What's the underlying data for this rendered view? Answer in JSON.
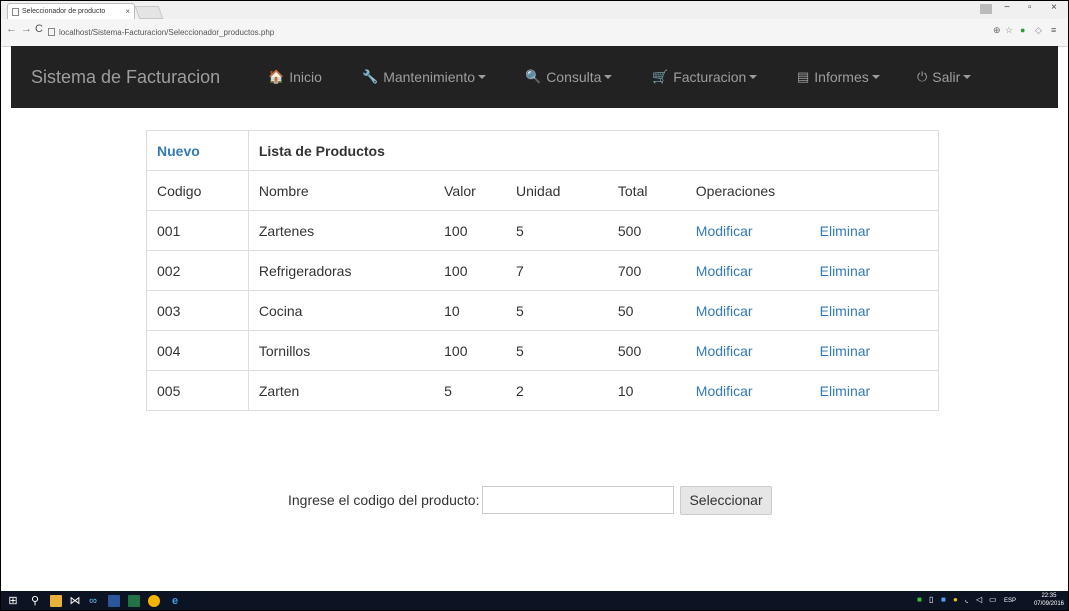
{
  "browser": {
    "tab_title": "Seleccionador de producto",
    "tab_close": "×",
    "url": "localhost/Sistema-Facturacion/Seleccionador_productos.php"
  },
  "navbar": {
    "brand": "Sistema de Facturacion",
    "items": [
      {
        "label": "Inicio",
        "icon": "home-icon",
        "glyph": "🏠"
      },
      {
        "label": "Mantenimiento",
        "icon": "wrench-icon",
        "glyph": "🔧"
      },
      {
        "label": "Consulta",
        "icon": "search-icon",
        "glyph": "🔍"
      },
      {
        "label": "Facturacion",
        "icon": "shopping-cart-icon",
        "glyph": "🛒"
      },
      {
        "label": "Informes",
        "icon": "list-alt-icon",
        "glyph": "▤"
      },
      {
        "label": "Salir",
        "icon": "power-off-icon",
        "glyph": "⏻"
      }
    ]
  },
  "table": {
    "new_label": "Nuevo",
    "title": "Lista de Productos",
    "headers": [
      "Codigo",
      "Nombre",
      "Valor",
      "Unidad",
      "Total",
      "Operaciones"
    ],
    "modify_label": "Modificar",
    "delete_label": "Eliminar",
    "rows": [
      {
        "codigo": "001",
        "nombre": "Zartenes",
        "valor": "100",
        "unidad": "5",
        "total": "500"
      },
      {
        "codigo": "002",
        "nombre": "Refrigeradoras",
        "valor": "100",
        "unidad": "7",
        "total": "700"
      },
      {
        "codigo": "003",
        "nombre": "Cocina",
        "valor": "10",
        "unidad": "5",
        "total": "50"
      },
      {
        "codigo": "004",
        "nombre": "Tornillos",
        "valor": "100",
        "unidad": "5",
        "total": "500"
      },
      {
        "codigo": "005",
        "nombre": "Zarten",
        "valor": "5",
        "unidad": "2",
        "total": "10"
      }
    ]
  },
  "form": {
    "label": "Ingrese el codigo del producto:",
    "input_value": "",
    "button": "Seleccionar"
  },
  "taskbar": {
    "lang": "ESP",
    "time": "22:35",
    "date": "07/09/2016"
  },
  "colors": {
    "navbar_bg": "#222222",
    "navbar_text": "#9d9d9d",
    "link": "#337ab7"
  }
}
